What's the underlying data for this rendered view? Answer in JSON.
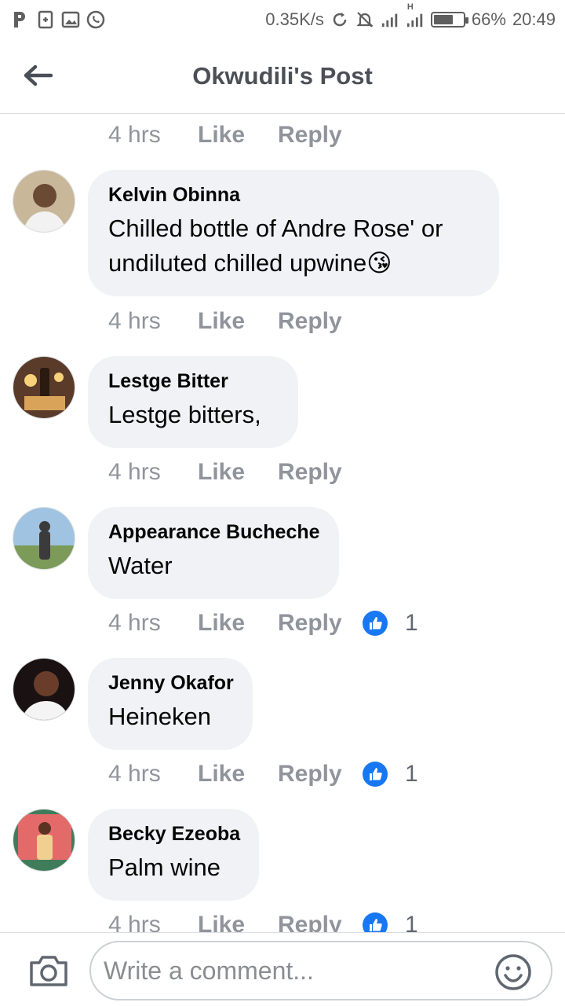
{
  "status_bar": {
    "left_icons": [
      "p-icon",
      "sim-icon",
      "gallery-icon",
      "whatsapp-icon"
    ],
    "speed": "0.35K/s",
    "network_type": "H",
    "battery": "66%",
    "battery_level": 0.66,
    "time": "20:49"
  },
  "header": {
    "title": "Okwudili's Post",
    "back_icon": "arrow-left-icon"
  },
  "top_meta": {
    "time": "4 hrs",
    "like": "Like",
    "reply": "Reply"
  },
  "comments": [
    {
      "author": "Kelvin Obinna",
      "text": "Chilled bottle of Andre Rose'  or",
      "text2": "undiluted chilled upwine",
      "emoji": "😘",
      "time": "4 hrs",
      "like": "Like",
      "reply": "Reply",
      "avatar_colors": [
        "#c9b79a",
        "#f2f2f2"
      ]
    },
    {
      "author": "Lestge Bitter",
      "text": "Lestge bitters,",
      "time": "4 hrs",
      "like": "Like",
      "reply": "Reply",
      "avatar_colors": [
        "#5a3b2a",
        "#d9a45a"
      ]
    },
    {
      "author": "Appearance Bucheche",
      "text": "Water",
      "time": "4 hrs",
      "like": "Like",
      "reply": "Reply",
      "reactions": "1",
      "avatar_colors": [
        "#9fc3e0",
        "#3b3b3b"
      ]
    },
    {
      "author": "Jenny Okafor",
      "text": "Heineken",
      "time": "4 hrs",
      "like": "Like",
      "reply": "Reply",
      "reactions": "1",
      "avatar_colors": [
        "#1a1212",
        "#f4f4f4"
      ]
    },
    {
      "author": "Becky Ezeoba",
      "text": "Palm wine",
      "time": "4 hrs",
      "like": "Like",
      "reply": "Reply",
      "reactions": "1",
      "avatar_colors": [
        "#e46a6a",
        "#f0d090"
      ]
    }
  ],
  "composer": {
    "placeholder": "Write a comment...",
    "camera_icon": "camera-icon",
    "emoji_icon": "smiley-icon"
  },
  "colors": {
    "bubble": "#f0f2f5",
    "meta": "#90949c",
    "like_blue": "#1877f2"
  }
}
